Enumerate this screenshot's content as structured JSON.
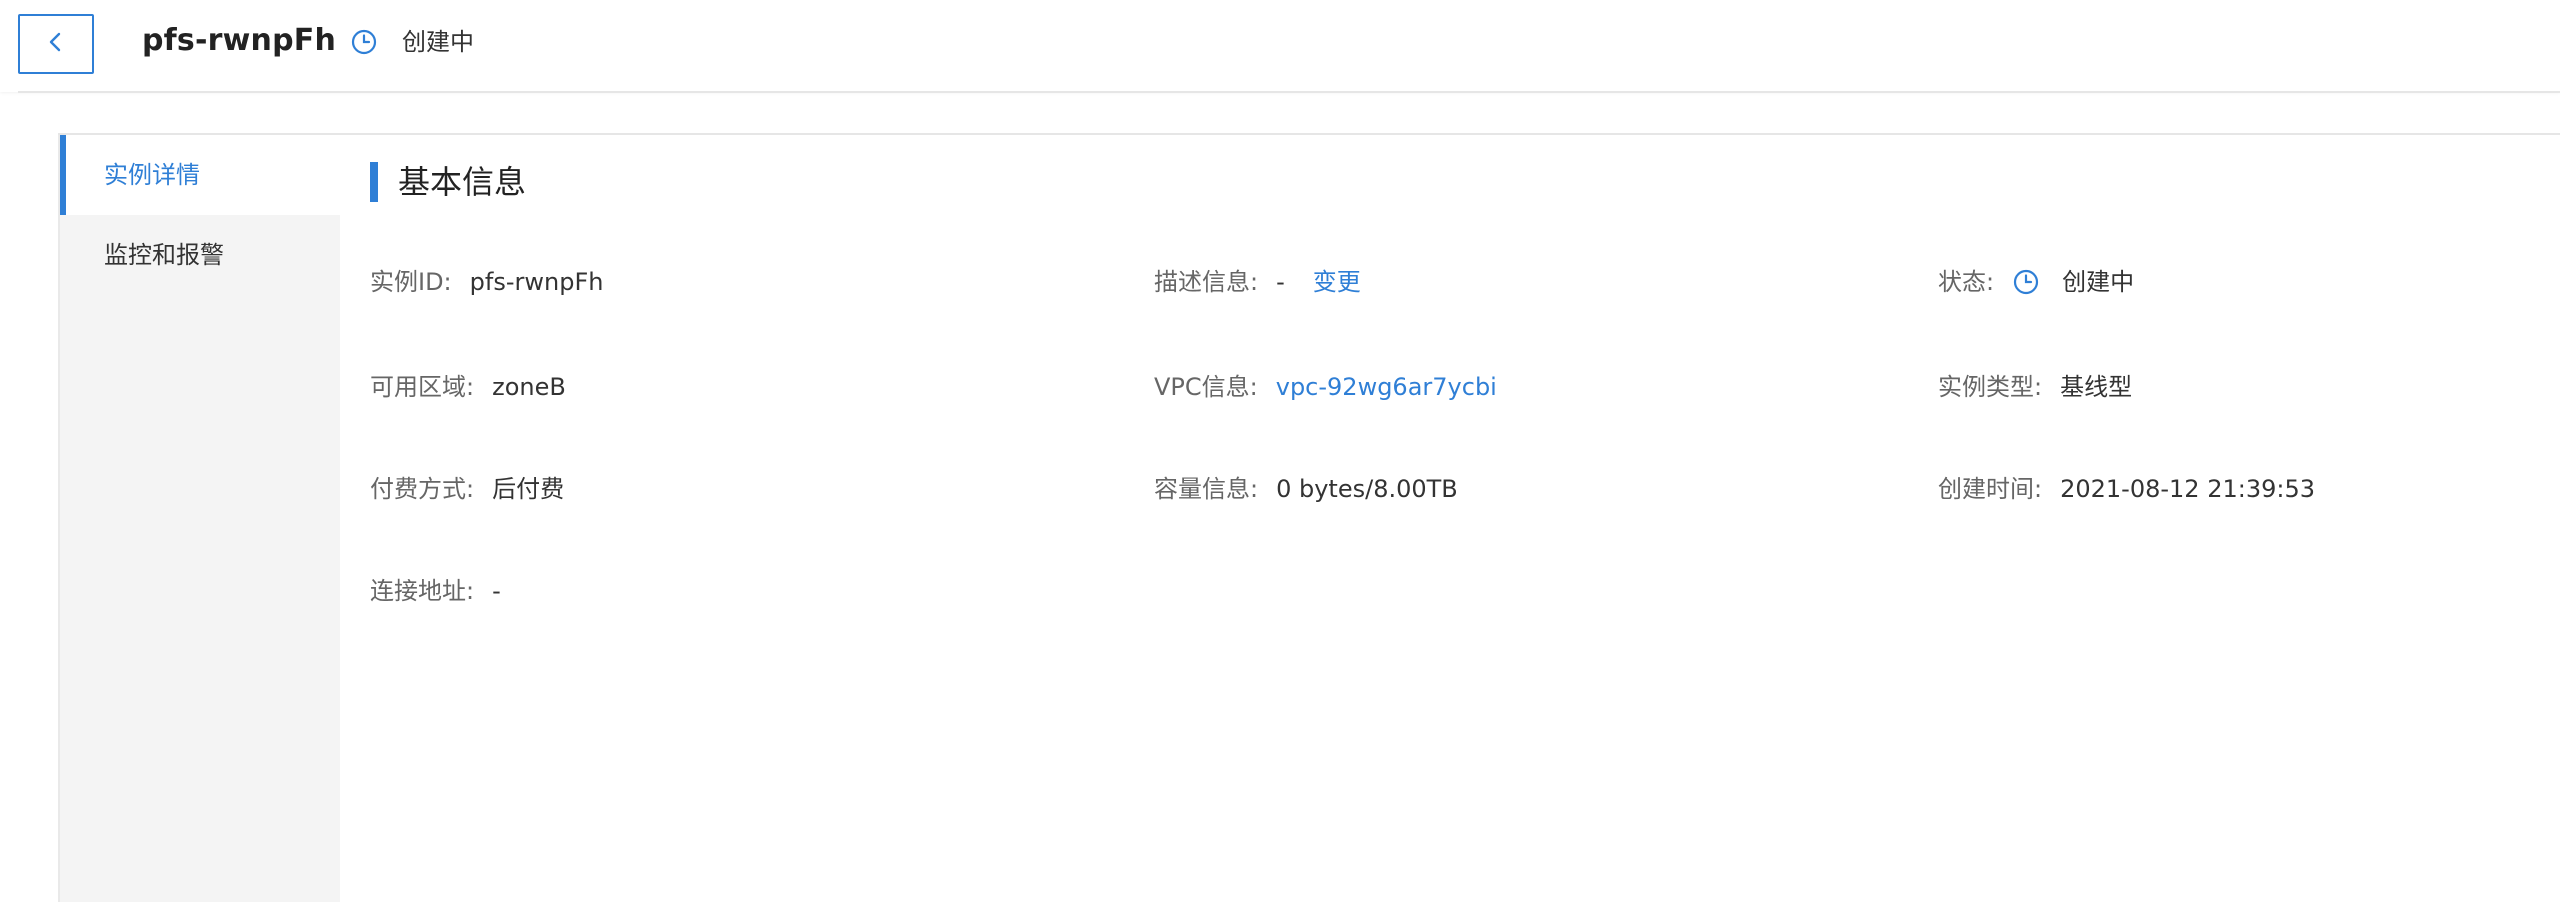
{
  "header": {
    "title": "pfs-rwnpFh",
    "status": "创建中"
  },
  "sidebar": {
    "items": [
      {
        "label": "实例详情"
      },
      {
        "label": "监控和报警"
      }
    ]
  },
  "section": {
    "title": "基本信息"
  },
  "fields": {
    "instance_id": {
      "label": "实例ID:",
      "value": "pfs-rwnpFh"
    },
    "description": {
      "label": "描述信息:",
      "value": "-",
      "action": "变更"
    },
    "status": {
      "label": "状态:",
      "value": "创建中"
    },
    "zone": {
      "label": "可用区域:",
      "value": "zoneB"
    },
    "vpc": {
      "label": "VPC信息:",
      "value": "vpc-92wg6ar7ycbi"
    },
    "instance_type": {
      "label": "实例类型:",
      "value": "基线型"
    },
    "billing": {
      "label": "付费方式:",
      "value": "后付费"
    },
    "capacity": {
      "label": "容量信息:",
      "value": "0 bytes/8.00TB"
    },
    "created_at": {
      "label": "创建时间:",
      "value": "2021-08-12 21:39:53"
    },
    "endpoint": {
      "label": "连接地址:",
      "value": "-"
    }
  },
  "colors": {
    "accent": "#2f7fd6",
    "sidebar_bg": "#f4f4f4"
  },
  "icons": [
    "chevron-left-icon",
    "clock-icon"
  ]
}
